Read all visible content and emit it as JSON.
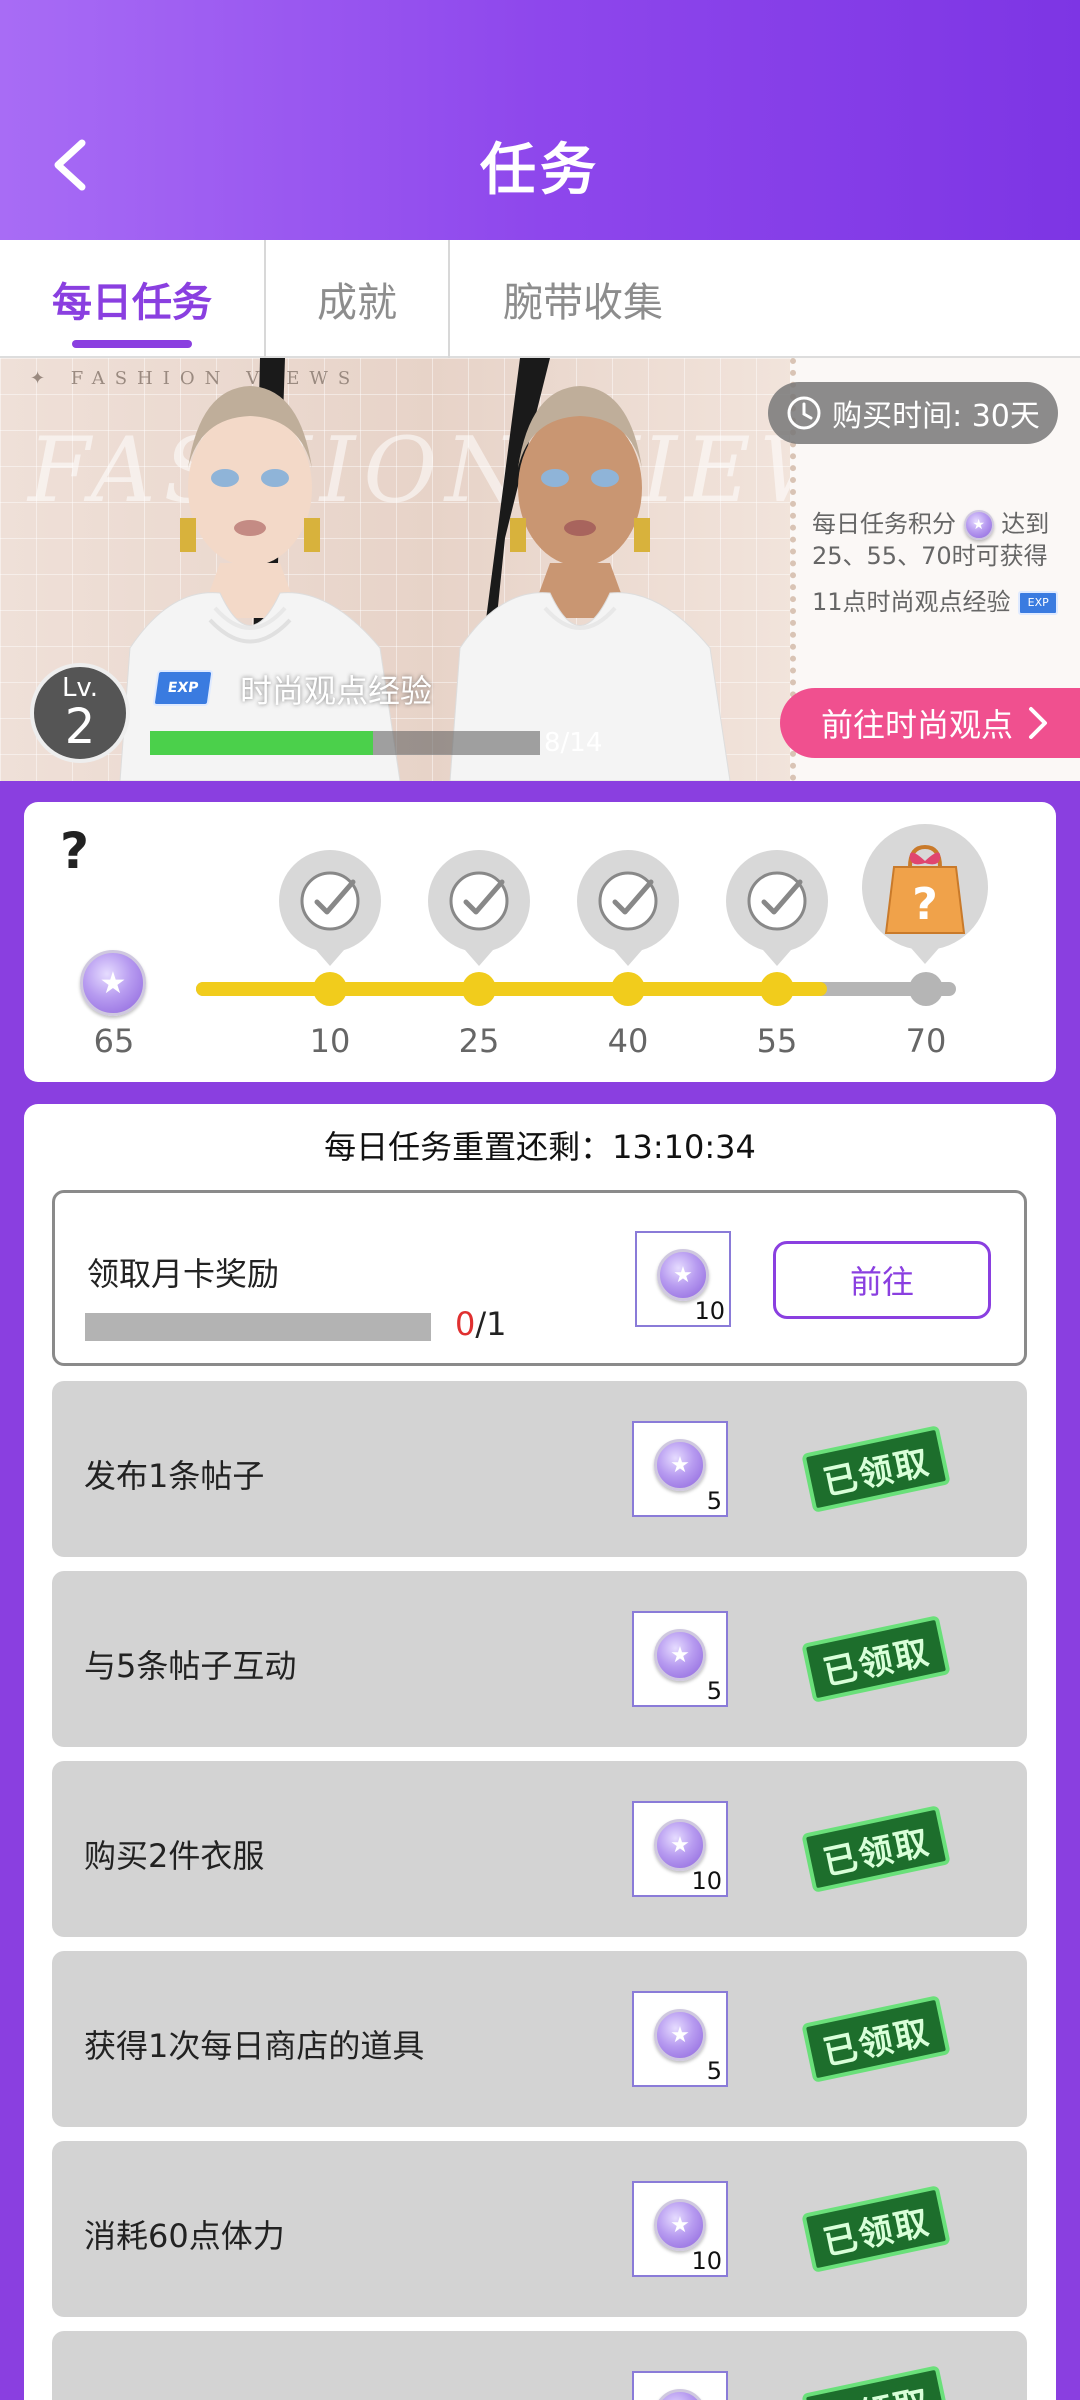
{
  "header": {
    "title": "任务"
  },
  "tabs": [
    {
      "label": "每日任务",
      "active": true
    },
    {
      "label": "成就",
      "active": false
    },
    {
      "label": "腕带收集",
      "active": false
    }
  ],
  "banner": {
    "top_text": "✦ FASHION                 VIEWS",
    "watermark": "FASHION VIEWS",
    "buy_time": "购买时间: 30天",
    "desc_line1": "每日任务积分",
    "desc_line1b": "达到",
    "desc_line2": "25、55、70时可获得",
    "desc_line3": "11点时尚观点经验",
    "goto_button": "前往时尚观点",
    "level_label": "Lv.",
    "level": "2",
    "exp_label": "时尚观点经验",
    "exp_icon_text": "EXP",
    "exp_count": "8/14",
    "exp_progress": 0.5714
  },
  "progress": {
    "help": "?",
    "current_points": "65",
    "fill_fraction": 0.83,
    "milestones": [
      {
        "value": "10",
        "claimed": true
      },
      {
        "value": "25",
        "claimed": true
      },
      {
        "value": "40",
        "claimed": true
      },
      {
        "value": "55",
        "claimed": true
      },
      {
        "value": "70",
        "claimed": false
      }
    ],
    "colors": {
      "fill": "#f1cc1c",
      "track": "#b5b5b5"
    }
  },
  "tasks": {
    "reset_text": "每日任务重置还剩：13:10:34",
    "items": [
      {
        "name": "领取月卡奖励",
        "reward": "10",
        "status": "go",
        "button": "前往",
        "progress_done": "0",
        "progress_total": "/1"
      },
      {
        "name": "发布1条帖子",
        "reward": "5",
        "status": "claimed",
        "stamp": "已领取"
      },
      {
        "name": "与5条帖子互动",
        "reward": "5",
        "status": "claimed",
        "stamp": "已领取"
      },
      {
        "name": "购买2件衣服",
        "reward": "10",
        "status": "claimed",
        "stamp": "已领取"
      },
      {
        "name": "获得1次每日商店的道具",
        "reward": "5",
        "status": "claimed",
        "stamp": "已领取"
      },
      {
        "name": "消耗60点体力",
        "reward": "10",
        "status": "claimed",
        "stamp": "已领取"
      },
      {
        "name": "",
        "reward": "",
        "status": "claimed",
        "stamp": "已领取"
      }
    ]
  },
  "colors": {
    "accent": "#8a3fe0",
    "pink": "#f0508f",
    "claimed_green": "#1d6e2c"
  }
}
